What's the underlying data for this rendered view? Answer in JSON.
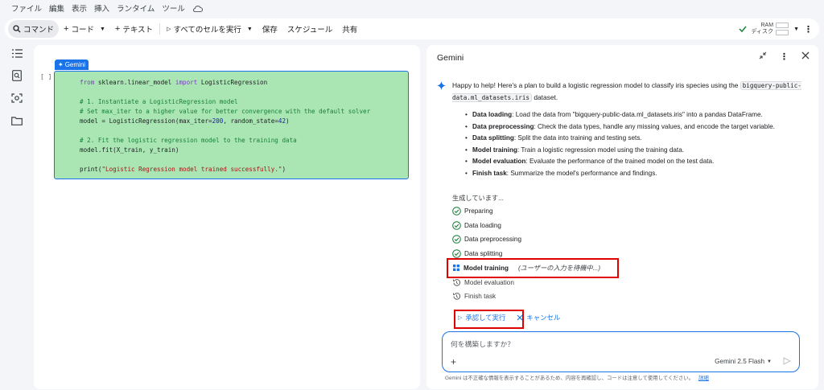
{
  "menu": [
    "ファイル",
    "編集",
    "表示",
    "挿入",
    "ランタイム",
    "ツール"
  ],
  "toolbar": {
    "command": "コマンド",
    "code": "コード",
    "text": "テキスト",
    "run_all": "すべてのセルを実行",
    "save": "保存",
    "schedule": "スケジュール",
    "share": "共有",
    "ram": "RAM",
    "disk": "ディスク"
  },
  "cell": {
    "tag": "Gemini",
    "bracket": "[ ]",
    "lines": {
      "l1a": "from",
      "l1b": " sklearn.linear_model ",
      "l1c": "import",
      "l1d": " LogisticRegression",
      "l2": "# 1. Instantiate a LogisticRegression model",
      "l3": "# Set max_iter to a higher value for better convergence with the default solver",
      "l4a": "model = LogisticRegression(max_iter=",
      "l4b": "200",
      "l4c": ", random_state=",
      "l4d": "42",
      "l4e": ")",
      "l5": "# 2. Fit the logistic regression model to the training data",
      "l6": "model.fit(X_train, y_train)",
      "l7a": "print(",
      "l7b": "\"Logistic Regression model trained successfully.\"",
      "l7c": ")"
    }
  },
  "panel": {
    "title": "Gemini",
    "intro_a": "Happy to help! Here's a plan to build a logistic regression model to classify iris species using the ",
    "intro_code": "bigquery-public-data.ml_datasets.iris",
    "intro_b": " dataset.",
    "plan": [
      {
        "bold": "Data loading",
        "text": ": Load the data from \"bigquery-public-data.ml_datasets.iris\" into a pandas DataFrame."
      },
      {
        "bold": "Data preprocessing",
        "text": ": Check the data types, handle any missing values, and encode the target variable."
      },
      {
        "bold": "Data splitting",
        "text": ": Split the data into training and testing sets."
      },
      {
        "bold": "Model training",
        "text": ": Train a logistic regression model using the training data."
      },
      {
        "bold": "Model evaluation",
        "text": ": Evaluate the performance of the trained model on the test data."
      },
      {
        "bold": "Finish task",
        "text": ": Summarize the model's performance and findings."
      }
    ],
    "generating": "生成しています...",
    "steps": [
      {
        "label": "Preparing",
        "state": "done"
      },
      {
        "label": "Data loading",
        "state": "done"
      },
      {
        "label": "Data preprocessing",
        "state": "done"
      },
      {
        "label": "Data splitting",
        "state": "done"
      },
      {
        "label": "Model training",
        "state": "waiting",
        "note": "(ユーザーの入力を待機中...)"
      },
      {
        "label": "Model evaluation",
        "state": "pending"
      },
      {
        "label": "Finish task",
        "state": "pending"
      }
    ],
    "approve": "承認して実行",
    "cancel": "キャンセル",
    "input_placeholder": "何を構築しますか？",
    "model_name": "Gemini 2.5 Flash",
    "disclaimer": "Gemini は不正確な情報を表示することがあるため、内容を再確認し、コードは注意して使用してください。",
    "disclaimer_link": "詳細"
  },
  "colors": {
    "accent": "#1a73e8",
    "cell_bg": "#a9e6b3",
    "highlight": "#e00000",
    "check": "#188038"
  }
}
